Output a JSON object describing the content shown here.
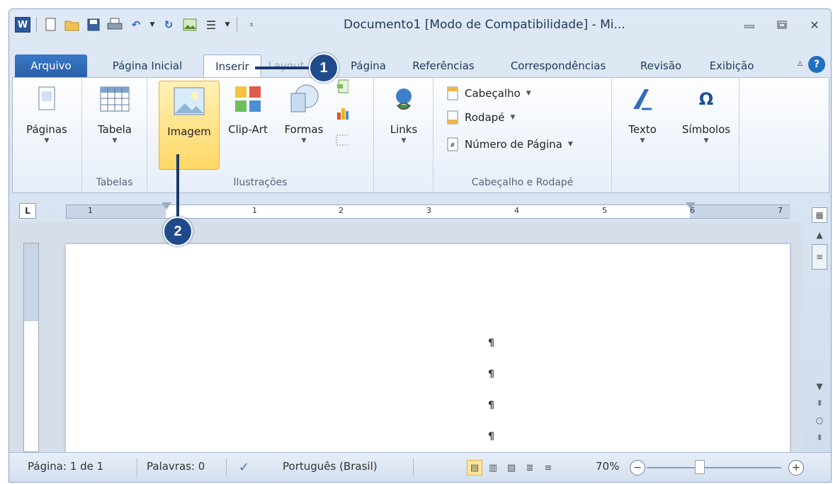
{
  "titlebar": {
    "title": "Documento1 [Modo de Compatibilidade] - Mi...",
    "qat_icons": [
      "word-icon",
      "new-doc-icon",
      "open-folder-icon",
      "save-icon",
      "print-icon",
      "undo-icon",
      "redo-icon",
      "picture-icon",
      "list-icon",
      "customize-qat-icon"
    ]
  },
  "tabs": {
    "file": "Arquivo",
    "home": "Página Inicial",
    "insert": "Inserir",
    "layout": "Layout",
    "page": "Página",
    "references": "Referências",
    "mailings": "Correspondências",
    "review": "Revisão",
    "view": "Exibição",
    "help": "?"
  },
  "ribbon": {
    "pages": {
      "label": "Páginas"
    },
    "tables": {
      "table_label": "Tabela",
      "group": "Tabelas"
    },
    "illustrations": {
      "picture": "Imagem",
      "clipart": "Clip-Art",
      "shapes": "Formas",
      "group": "Ilustrações"
    },
    "links": {
      "label": "Links"
    },
    "header_footer": {
      "header": "Cabeçalho",
      "footer": "Rodapé",
      "page_number": "Número de Página",
      "group": "Cabeçalho e Rodapé"
    },
    "text": {
      "label": "Texto"
    },
    "symbols": {
      "label": "Símbolos"
    }
  },
  "ruler": {
    "numbers": [
      "1",
      "1",
      "2",
      "3",
      "4",
      "5",
      "6",
      "7"
    ]
  },
  "document": {
    "pilcrow": "¶"
  },
  "statusbar": {
    "page": "Página: 1 de 1",
    "words": "Palavras: 0",
    "language": "Português (Brasil)",
    "zoom": "70%"
  },
  "callouts": {
    "one": "1",
    "two": "2"
  },
  "colors": {
    "accent": "#2b579a",
    "callout": "#1f4a8c",
    "file_tab": "#2a5fa8",
    "selected": "#ffd766"
  }
}
